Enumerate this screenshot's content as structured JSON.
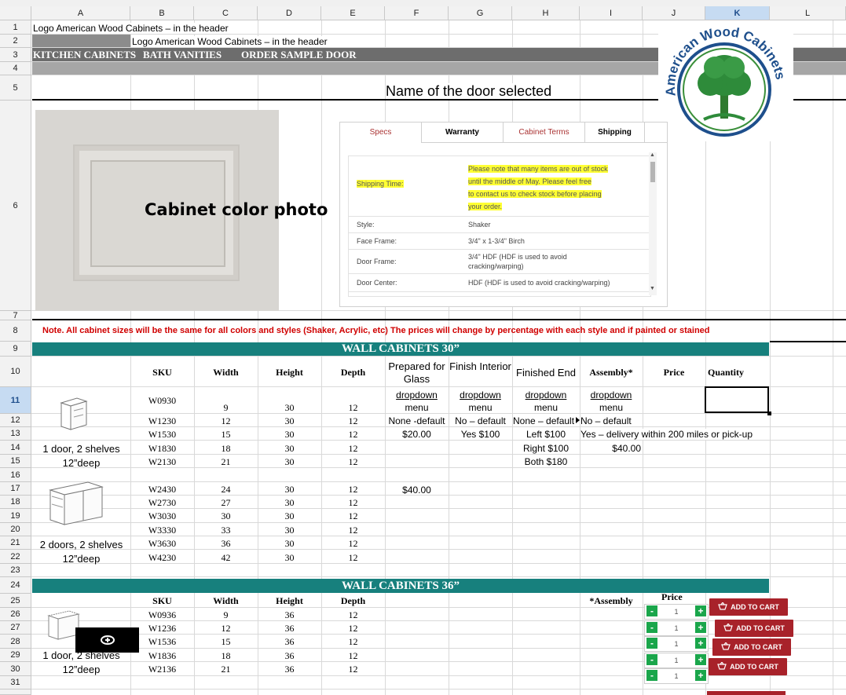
{
  "columns": [
    "A",
    "B",
    "C",
    "D",
    "E",
    "F",
    "G",
    "H",
    "I",
    "J",
    "K",
    "L"
  ],
  "rows": [
    "1",
    "2",
    "3",
    "4",
    "5",
    "6",
    "7",
    "8",
    "9",
    "10",
    "11",
    "12",
    "13",
    "14",
    "15",
    "16",
    "17",
    "18",
    "19",
    "20",
    "21",
    "22",
    "23",
    "24",
    "25",
    "26",
    "27",
    "28",
    "29",
    "30",
    "31"
  ],
  "header": {
    "row1": "Logo American Wood Cabinets – in the header",
    "row2": "Logo American Wood Cabinets – in the header",
    "nav": [
      "KITCHEN CABINETS",
      "BATH VANITIES",
      "ORDER SAMPLE DOOR"
    ]
  },
  "logo_text": "American Wood Cabinets",
  "door_title": "Name of the door selected",
  "photo_caption": "Cabinet color photo",
  "tabs": [
    "Specs",
    "Warranty",
    "Cabinet Terms",
    "Shipping"
  ],
  "specs": {
    "shipping_label": "Shipping Time:",
    "shipping_lines": [
      "Please note that many items are out of stock",
      "until the middle of May. Please feel free",
      "to contact us to check stock before placing",
      "your order."
    ],
    "rows": [
      {
        "label": "Style:",
        "value": "Shaker"
      },
      {
        "label": "Face Frame:",
        "value": "3/4\" x 1-3/4\" Birch"
      },
      {
        "label": "Door Frame:",
        "value": "3/4\" HDF (HDF is used to avoid cracking/warping)"
      },
      {
        "label": "Door Center:",
        "value": "HDF (HDF is used to avoid cracking/warping)"
      }
    ]
  },
  "note": "Note. All cabinet sizes will be the same for all colors and styles (Shaker, Acrylic, etc)  The prices will change by percentage with each style and if painted or stained",
  "wall30": {
    "title": "WALL CABINETS 30”",
    "headers": {
      "sku": "SKU",
      "width": "Width",
      "height": "Height",
      "depth": "Depth",
      "glass": "Prepared for Glass",
      "interior": "Finish Interior",
      "end": "Finished End",
      "assembly": "Assembly*",
      "price": "Price",
      "quantity": "Quantity"
    },
    "dropdown": "dropdown",
    "menu": "menu",
    "options": {
      "glass": [
        "None -default",
        "$20.00",
        "$40.00"
      ],
      "interior": [
        "No – default",
        "Yes $100"
      ],
      "end": [
        "None – default",
        "Left $100",
        "Right $100",
        "Both $180"
      ],
      "assembly": [
        "No – default",
        "Yes – delivery within 200 miles or pick-up",
        "$40.00"
      ]
    },
    "group1_label": [
      "1 door, 2 shelves",
      "12”deep"
    ],
    "group2_label": [
      "2 doors, 2 shelves",
      "12”deep"
    ],
    "items": [
      {
        "sku": "W0930",
        "w": "9",
        "h": "30",
        "d": "12"
      },
      {
        "sku": "W1230",
        "w": "12",
        "h": "30",
        "d": "12"
      },
      {
        "sku": "W1530",
        "w": "15",
        "h": "30",
        "d": "12"
      },
      {
        "sku": "W1830",
        "w": "18",
        "h": "30",
        "d": "12"
      },
      {
        "sku": "W2130",
        "w": "21",
        "h": "30",
        "d": "12"
      },
      {
        "sku": "W2430",
        "w": "24",
        "h": "30",
        "d": "12"
      },
      {
        "sku": "W2730",
        "w": "27",
        "h": "30",
        "d": "12"
      },
      {
        "sku": "W3030",
        "w": "30",
        "h": "30",
        "d": "12"
      },
      {
        "sku": "W3330",
        "w": "33",
        "h": "30",
        "d": "12"
      },
      {
        "sku": "W3630",
        "w": "36",
        "h": "30",
        "d": "12"
      },
      {
        "sku": "W4230",
        "w": "42",
        "h": "30",
        "d": "12"
      }
    ]
  },
  "wall36": {
    "title": "WALL CABINETS 36”",
    "headers": {
      "sku": "SKU",
      "width": "Width",
      "height": "Height",
      "depth": "Depth",
      "assembly": "*Assembly",
      "price": "Price"
    },
    "group_label": [
      "1 door, 2 shelves",
      "12”deep"
    ],
    "items": [
      {
        "sku": "W0936",
        "w": "9",
        "h": "36",
        "d": "12"
      },
      {
        "sku": "W1236",
        "w": "12",
        "h": "36",
        "d": "12"
      },
      {
        "sku": "W1536",
        "w": "15",
        "h": "36",
        "d": "12"
      },
      {
        "sku": "W1836",
        "w": "18",
        "h": "36",
        "d": "12"
      },
      {
        "sku": "W2136",
        "w": "21",
        "h": "36",
        "d": "12"
      }
    ]
  },
  "cart": {
    "qty": "1",
    "minus": "-",
    "plus": "+",
    "button": "ADD TO CART"
  },
  "colors": {
    "teal": "#17807d",
    "gray_band": "#6d6d6d",
    "cart_red": "#a8222a",
    "green": "#1aa64b",
    "note_red": "#d00000"
  }
}
